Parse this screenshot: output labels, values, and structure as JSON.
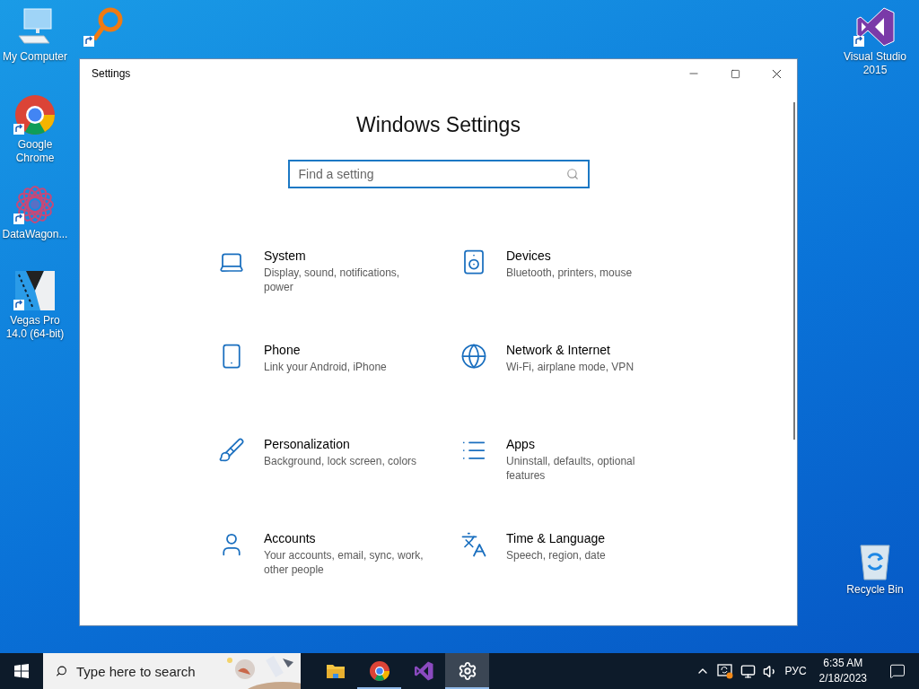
{
  "desktop_icons": [
    {
      "kind": "computer",
      "label": "My Computer"
    },
    {
      "kind": "magnifier"
    },
    {
      "kind": "browser",
      "label": "Google Chrome"
    },
    {
      "kind": "mandala",
      "label": "DataWagon..."
    },
    {
      "kind": "video-editor",
      "label": "Vegas Pro 14.0 (64-bit)"
    },
    {
      "kind": "ide",
      "label": "Visual Studio 2015"
    },
    {
      "kind": "recycle-bin",
      "label": "Recycle Bin"
    }
  ],
  "window": {
    "title": "Settings"
  },
  "settings": {
    "heading": "Windows Settings",
    "search": {
      "placeholder": "Find a setting"
    },
    "items": [
      {
        "kind": "laptop",
        "title": "System",
        "description": "Display, sound, notifications, power"
      },
      {
        "kind": "devices",
        "title": "Devices",
        "description": "Bluetooth, printers, mouse"
      },
      {
        "kind": "phone",
        "title": "Phone",
        "description": "Link your Android, iPhone"
      },
      {
        "kind": "globe",
        "title": "Network & Internet",
        "description": "Wi-Fi, airplane mode, VPN"
      },
      {
        "kind": "brush",
        "title": "Personalization",
        "description": "Background, lock screen, colors"
      },
      {
        "kind": "list",
        "title": "Apps",
        "description": "Uninstall, defaults, optional features"
      },
      {
        "kind": "person",
        "title": "Accounts",
        "description": "Your accounts, email, sync, work, other people"
      },
      {
        "kind": "language",
        "title": "Time & Language",
        "description": "Speech, region, date"
      }
    ]
  },
  "taskbar": {
    "search": {
      "placeholder": "Type here to search"
    },
    "apps": [
      {
        "kind": "folder",
        "selected": false,
        "running": false
      },
      {
        "kind": "browser",
        "selected": false,
        "running": true
      },
      {
        "kind": "ide",
        "selected": false,
        "running": false
      },
      {
        "kind": "settings",
        "selected": true,
        "running": true
      }
    ],
    "tray": {
      "language": "РУС",
      "time": "6:35 AM",
      "date": "2/18/2023"
    }
  }
}
